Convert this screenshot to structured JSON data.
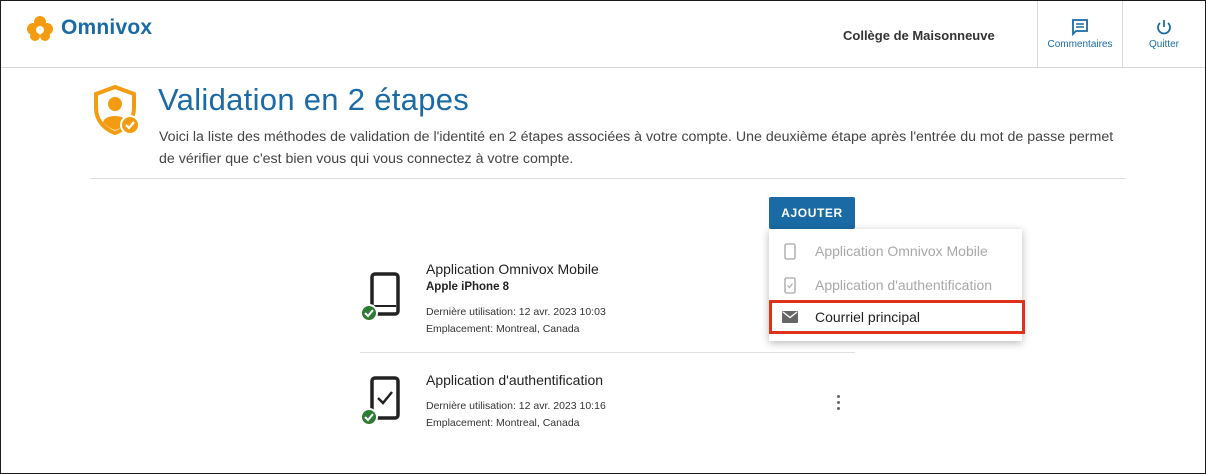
{
  "header": {
    "brand": "Omnivox",
    "college": "Collège de Maisonneuve",
    "comments_label": "Commentaires",
    "quit_label": "Quitter"
  },
  "page": {
    "title": "Validation en 2 étapes",
    "description": "Voici la liste des méthodes de validation de l'identité en 2 étapes associées à votre compte. Une deuxième étape après l'entrée du mot de passe permet de vérifier que c'est bien vous qui vous connectez à votre compte.",
    "add_label": "AJOUTER"
  },
  "methods": [
    {
      "name": "Application Omnivox Mobile",
      "device": "Apple iPhone 8",
      "last_used": "Dernière utilisation: 12 avr. 2023 10:03",
      "location": "Emplacement: Montreal, Canada",
      "icon": "phone-icon"
    },
    {
      "name": "Application d'authentification",
      "last_used": "Dernière utilisation: 12 avr. 2023 10:16",
      "location": "Emplacement: Montreal, Canada",
      "icon": "phone-check-icon"
    }
  ],
  "dropdown": {
    "items": [
      {
        "label": "Application Omnivox Mobile",
        "disabled": true,
        "icon": "phone-icon"
      },
      {
        "label": "Application d'authentification",
        "disabled": true,
        "icon": "phone-check-icon"
      },
      {
        "label": "Courriel principal",
        "disabled": false,
        "highlighted": true,
        "icon": "envelope-icon"
      }
    ]
  },
  "colors": {
    "accent": "#1a6aa5",
    "orange": "#f39c12",
    "green": "#2e7d32",
    "highlight": "#e0311b"
  }
}
